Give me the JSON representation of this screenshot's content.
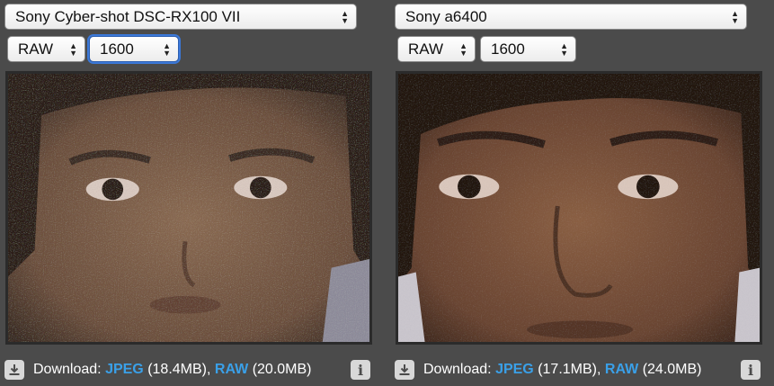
{
  "left": {
    "camera": "Sony Cyber-shot DSC-RX100 VII",
    "mode": "RAW",
    "iso": "1600",
    "download": {
      "label": "Download:",
      "jpeg_label": "JPEG",
      "jpeg_size": "(18.4MB),",
      "raw_label": "RAW",
      "raw_size": "(20.0MB)"
    }
  },
  "right": {
    "camera": "Sony a6400",
    "mode": "RAW",
    "iso": "1600",
    "download": {
      "label": "Download:",
      "jpeg_label": "JPEG",
      "jpeg_size": "(17.1MB),",
      "raw_label": "RAW",
      "raw_size": "(24.0MB)"
    }
  },
  "icons": {
    "select_arrows": "up-down-arrows-icon",
    "download": "download-icon",
    "info": "info-icon"
  },
  "colors": {
    "background": "#4b4b4b",
    "link": "#3aa0e8",
    "focus_ring": "#3b78d8"
  }
}
